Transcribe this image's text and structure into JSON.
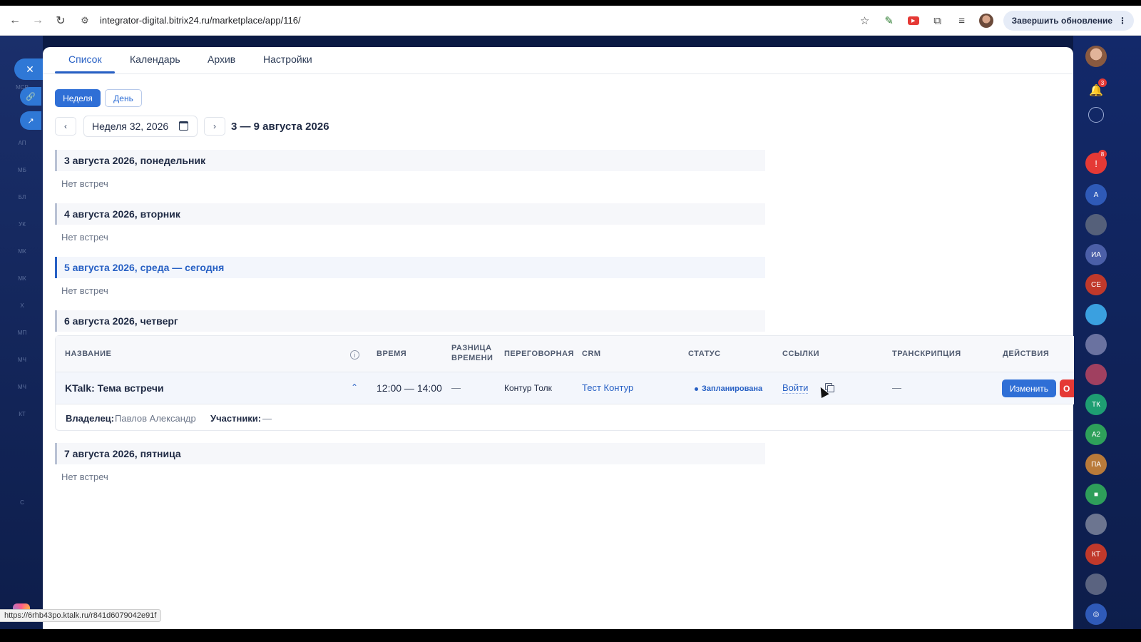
{
  "browser": {
    "url": "integrator-digital.bitrix24.ru/marketplace/app/116/",
    "update_label": "Завершить обновление"
  },
  "tabs": [
    {
      "label": "Список"
    },
    {
      "label": "Календарь"
    },
    {
      "label": "Архив"
    },
    {
      "label": "Настройки"
    }
  ],
  "view": {
    "week_label": "Неделя",
    "day_label": "День",
    "week_value": "Неделя 32, 2026",
    "range": "3 — 9 августа 2026"
  },
  "days": [
    {
      "title": "3 августа 2026, понедельник",
      "empty": "Нет встреч"
    },
    {
      "title": "4 августа 2026, вторник",
      "empty": "Нет встреч"
    },
    {
      "title": "5 августа 2026, среда — сегодня",
      "empty": "Нет встреч"
    },
    {
      "title": "6 августа 2026, четверг"
    },
    {
      "title": "7 августа 2026, пятница",
      "empty": "Нет встреч"
    }
  ],
  "table": {
    "headers": {
      "name": "НАЗВАНИЕ",
      "time": "ВРЕМЯ",
      "diff_1": "РАЗНИЦА",
      "diff_2": "ВРЕМЕНИ",
      "room": "ПЕРЕГОВОРНАЯ",
      "crm": "CRM",
      "status": "СТАТУС",
      "links": "ССЫЛКИ",
      "transcript": "ТРАНСКРИПЦИЯ",
      "actions": "ДЕЙСТВИЯ"
    },
    "row": {
      "title": "KTalk: Тема встречи",
      "time": "12:00 — 14:00",
      "diff": "—",
      "room": "Контур Толк",
      "crm": "Тест Контур",
      "status": "Запланирована",
      "join": "Войти",
      "transcript": "—",
      "edit": "Изменить",
      "cancel": "О"
    },
    "details": {
      "owner_label": "Владелец:",
      "owner": "Павлов Александр",
      "participants_label": "Участники:",
      "participants": "—"
    }
  },
  "status_url": "https://6rhb43po.ktalk.ru/r841d6079042e91f",
  "left_sidebar": {
    "items": [
      "МСР",
      "АП",
      "МБ",
      "БЛ",
      "УК",
      "МК",
      "МК",
      "Х",
      "МП",
      "МЧ",
      "МЧ",
      "КТ",
      "С"
    ]
  },
  "right_sidebar": {
    "notifications_badge": "3",
    "chat_badge": "8",
    "avatars": [
      "А",
      "ИА",
      "СЕ",
      "ТК",
      "А2",
      "ПА",
      "КТ"
    ]
  },
  "colors": {
    "accent": "#2760c4",
    "danger": "#e53935",
    "sidebar": "#0d1d4a"
  }
}
